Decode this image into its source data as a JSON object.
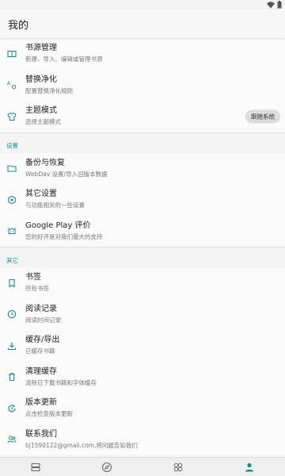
{
  "app": {
    "title": "我的"
  },
  "colors": {
    "accent": "#1f8a8a",
    "icon": "#1f8a8a",
    "nav_inactive": "#666666"
  },
  "main": {
    "group1": [
      {
        "title": "书源管理",
        "subtitle": "新建、导入、编辑或管理书源",
        "icon": "book-open-icon"
      },
      {
        "title": "替换净化",
        "subtitle": "配置替换净化规则",
        "icon": "replace-icon"
      },
      {
        "title": "主题模式",
        "subtitle": "选择主题模式",
        "icon": "shirt-icon",
        "chip": "跟随系统"
      }
    ],
    "section_settings": "设置",
    "group2": [
      {
        "title": "备份与恢复",
        "subtitle": "WebDav 设置/导入旧版本数据",
        "icon": "folder-icon"
      },
      {
        "title": "其它设置",
        "subtitle": "与功能相关的一些设置",
        "icon": "settings-icon"
      },
      {
        "title": "Google Play 评价",
        "subtitle": "您的好评是对我们最大的支持",
        "icon": "heart-face-icon"
      }
    ],
    "section_other": "其它",
    "group3": [
      {
        "title": "书签",
        "subtitle": "所有书签",
        "icon": "bookmark-icon"
      },
      {
        "title": "阅读记录",
        "subtitle": "阅读时间记录",
        "icon": "clock-icon"
      },
      {
        "title": "缓存/导出",
        "subtitle": "已缓存书籍",
        "icon": "download-icon"
      },
      {
        "title": "清理缓存",
        "subtitle": "清除已下载书籍和字体缓存",
        "icon": "trash-icon"
      },
      {
        "title": "版本更新",
        "subtitle": "点击检查版本更新",
        "icon": "update-icon"
      },
      {
        "title": "联系我们",
        "subtitle": "bj1590122@gmail.com,将问题告知我们",
        "icon": "contacts-icon"
      }
    ]
  },
  "bottom_nav": [
    {
      "name": "bookshelf",
      "icon": "bookshelf-icon",
      "active": false
    },
    {
      "name": "discover",
      "icon": "compass-icon",
      "active": false
    },
    {
      "name": "rss",
      "icon": "grid-icon",
      "active": false
    },
    {
      "name": "my",
      "icon": "person-icon",
      "active": true
    }
  ]
}
